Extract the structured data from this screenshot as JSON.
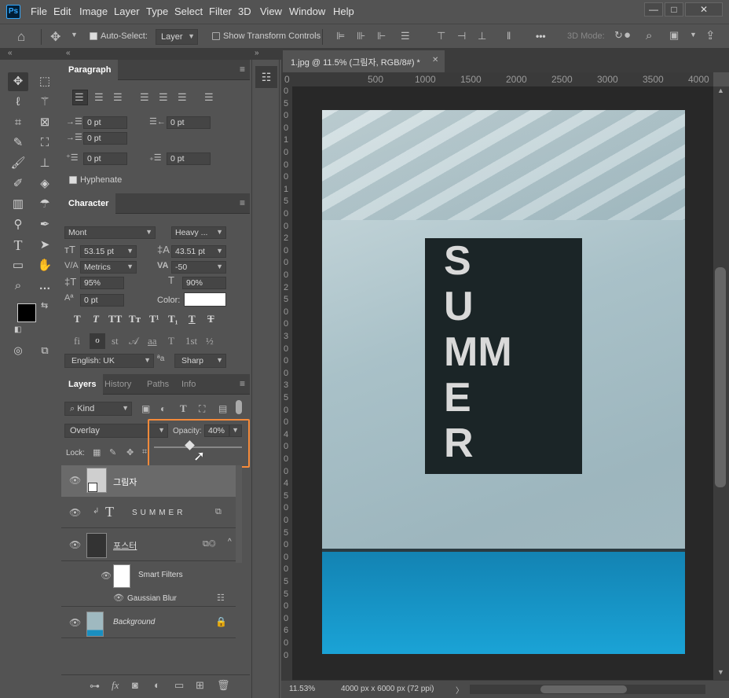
{
  "app": {
    "logo": "Ps",
    "menu": [
      "File",
      "Edit",
      "Image",
      "Layer",
      "Type",
      "Select",
      "Filter",
      "3D",
      "View",
      "Window",
      "Help"
    ]
  },
  "window_buttons": [
    "—",
    "□",
    "✕"
  ],
  "options_bar": {
    "auto_select_label": "Auto-Select:",
    "auto_select_value": "Layer",
    "show_transform_label": "Show Transform Controls",
    "mode_3d_label": "3D Mode:",
    "more": "•••"
  },
  "document_tab": {
    "title": "1.jpg @ 11.5% (그림자, RGB/8#) *",
    "close": "✕"
  },
  "ruler": {
    "h_ticks": [
      "0",
      "500",
      "1000",
      "1500",
      "2000",
      "2500",
      "3000",
      "3500",
      "4000"
    ],
    "v_digits": [
      "0",
      "5",
      "0",
      "0",
      "1",
      "0",
      "0",
      "0",
      "1",
      "5",
      "0",
      "0",
      "2",
      "0",
      "0",
      "0",
      "2",
      "5",
      "0",
      "0",
      "3",
      "0",
      "0",
      "0",
      "3",
      "5",
      "0",
      "0",
      "4",
      "0",
      "0",
      "0",
      "4",
      "5",
      "0",
      "0",
      "5",
      "0",
      "0",
      "0",
      "5",
      "5",
      "0",
      "0",
      "6",
      "0",
      "0"
    ]
  },
  "paragraph_panel": {
    "tab": "Paragraph",
    "fields": [
      "0 pt",
      "0 pt",
      "0 pt",
      "0 pt",
      "0 pt"
    ],
    "hyphenate_label": "Hyphenate"
  },
  "character_panel": {
    "tab": "Character",
    "font_family": "Mont",
    "font_style": "Heavy ...",
    "font_size": "53.15 pt",
    "leading": "43.51 pt",
    "kerning": "Metrics",
    "tracking": "-50",
    "vertical_scale": "95%",
    "horizontal_scale": "90%",
    "baseline_shift": "0 pt",
    "color_label": "Color:",
    "language": "English: UK",
    "aa_label": "ªa",
    "antialias": "Sharp",
    "style_buttons": [
      "T",
      "T",
      "TT",
      "Tт",
      "T¹",
      "T₁",
      "T",
      "T"
    ],
    "opentype_buttons": [
      "fi",
      "ℴ",
      "st",
      "𝒜",
      "aa",
      "T",
      "1st",
      "½"
    ]
  },
  "layers_panel": {
    "tabs": [
      "Layers",
      "History",
      "Paths",
      "Info"
    ],
    "filter_label": "Kind",
    "blend_mode": "Overlay",
    "opacity_label": "Opacity:",
    "opacity_value": "40%",
    "opacity_fraction": 0.4,
    "lock_label": "Lock:",
    "layers": [
      {
        "name": "그림자",
        "italic": false
      },
      {
        "name": "SUMMER",
        "italic": false
      },
      {
        "name": "포스터",
        "italic": false
      },
      {
        "name": "Smart Filters",
        "italic": false
      },
      {
        "name": "Gaussian Blur",
        "italic": false
      },
      {
        "name": "Background",
        "italic": true
      }
    ],
    "bottom_icons": [
      "link-icon",
      "fx-icon",
      "mask-icon",
      "adjustment-icon",
      "folder-icon",
      "new-layer-icon",
      "trash-icon"
    ]
  },
  "artwork": {
    "word": [
      "S",
      "U",
      "MM",
      "E",
      "R"
    ]
  },
  "status_bar": {
    "zoom": "11.53%",
    "doc_info": "4000 px x 6000 px (72 ppi)",
    "arrow": "〉"
  },
  "colors": {
    "accent_highlight": "#f58a3a",
    "poster_blue": "#1aa3d6",
    "wall": "#a7bfc6"
  }
}
